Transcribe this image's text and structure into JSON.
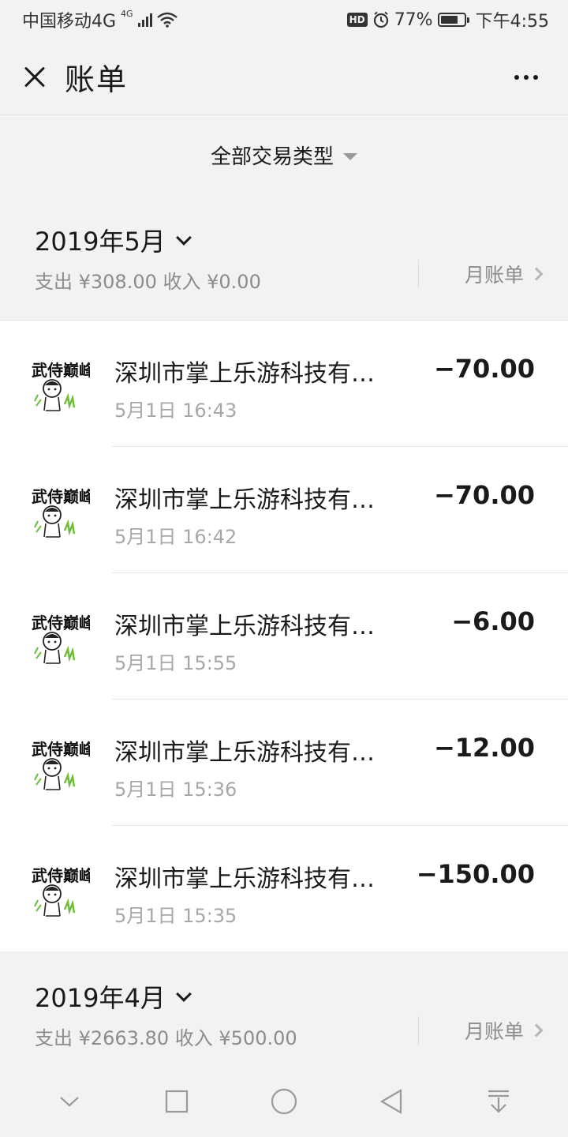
{
  "status_bar": {
    "carrier": "中国移动4G",
    "network_badge": "4G",
    "hd_label": "HD",
    "battery_percent": "77%",
    "battery_level": 0.77,
    "time": "下午4:55"
  },
  "header": {
    "title": "账单",
    "close_icon": "close-icon",
    "more_icon": "more-dots-icon"
  },
  "filter": {
    "label": "全部交易类型"
  },
  "months": [
    {
      "title": "2019年5月",
      "summary": "支出 ¥308.00 收入 ¥0.00",
      "bill_link": "月账单"
    },
    {
      "title": "2019年4月",
      "summary": "支出 ¥2663.80 收入 ¥500.00",
      "bill_link": "月账单"
    }
  ],
  "transactions": [
    {
      "name": "深圳市掌上乐游科技有限公司",
      "time": "5月1日 16:43",
      "amount": "−70.00"
    },
    {
      "name": "深圳市掌上乐游科技有限公司",
      "time": "5月1日 16:42",
      "amount": "−70.00"
    },
    {
      "name": "深圳市掌上乐游科技有限公司",
      "time": "5月1日 15:55",
      "amount": "−6.00"
    },
    {
      "name": "深圳市掌上乐游科技有限公司",
      "time": "5月1日 15:36",
      "amount": "−12.00"
    },
    {
      "name": "深圳市掌上乐游科技有限公司",
      "time": "5月1日 15:35",
      "amount": "−150.00"
    }
  ],
  "avatar_logo_text": "武侍巅峰",
  "nav": {
    "icons": [
      "collapse-down-icon",
      "recents-square-icon",
      "home-circle-icon",
      "back-triangle-icon",
      "notification-pull-icon"
    ]
  },
  "colors": {
    "background": "#f2f2f2",
    "card": "#ffffff",
    "secondary_text": "#8c8c8c"
  }
}
